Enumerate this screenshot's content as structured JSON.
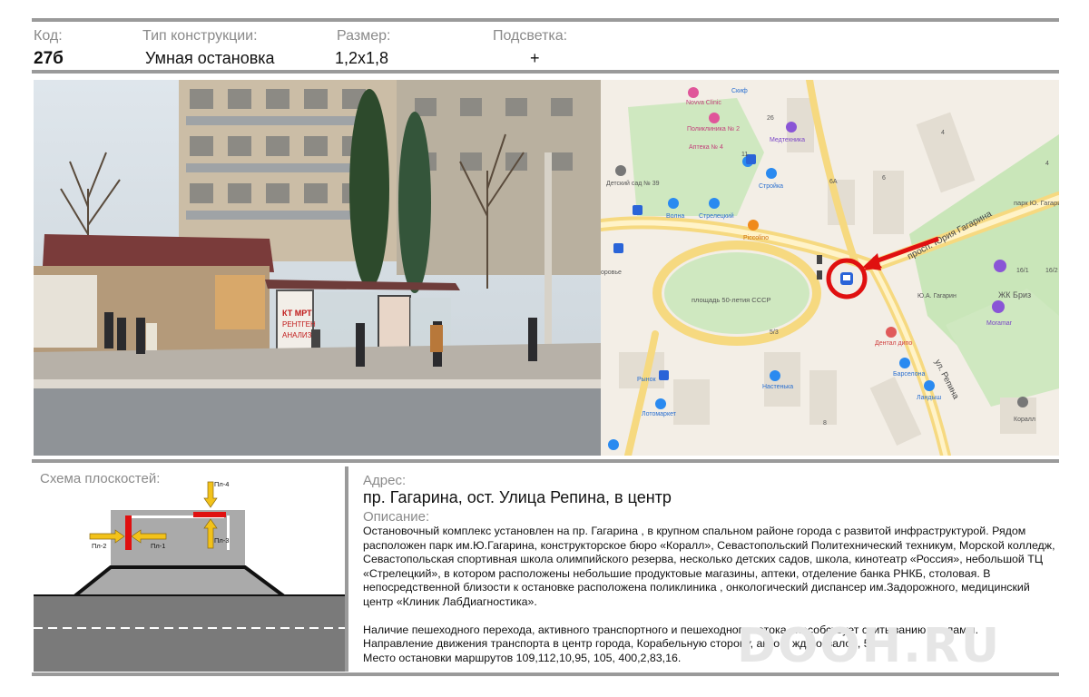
{
  "header": {
    "labels": {
      "code": "Код:",
      "type": "Тип конструкции:",
      "size": "Размер:",
      "light": "Подсветка:"
    },
    "values": {
      "code": "27б",
      "type": "Умная остановка",
      "size": "1,2x1,8",
      "light": "+"
    }
  },
  "photo": {
    "sign_line1": "КТ МРТ",
    "sign_line2": "РЕНТГЕН",
    "sign_line3": "АНАЛИЗЫ"
  },
  "map": {
    "labels": {
      "novva": "Novva Clinic",
      "skif": "Скиф",
      "poliklinika": "Поликлиника № 2",
      "apteka": "Аптека № 4",
      "medtehnika": "Медтехника",
      "stroyka": "Стройка",
      "detsad": "Детский сад № 39",
      "volna": "Волна",
      "streletsky": "Стрелецкий",
      "picollino": "Piccolino",
      "zdorovye": "оровье",
      "prospekt": "просп. Юрия Гагарина",
      "park": "парк Ю. Гагарина",
      "ploshad": "площадь 50-летия СССР",
      "yua": "Ю.А. Гагарин",
      "zhk": "ЖК Бриз",
      "moramar": "Moramar",
      "dental": "Дентал дипо",
      "rynok": "Рынок",
      "nastenka": "Настенька",
      "barselona": "Барселона",
      "landysh": "Ландыш",
      "ulrepina": "ул. Репина",
      "lotomarket": "Лотомаркет",
      "korall": "Коралл",
      "n26": "26",
      "n11": "11",
      "n4": "4",
      "n6a": "6А",
      "n6": "6",
      "n53": "5/3",
      "n8": "8",
      "n161": "16/1",
      "n162": "16/2",
      "n4b": "4"
    }
  },
  "schema": {
    "title": "Схема плоскостей:",
    "planes": {
      "p1": "Пл-1",
      "p2": "Пл-2",
      "p3": "Пл-3",
      "p4": "Пл-4"
    }
  },
  "info": {
    "address_label": "Адрес:",
    "address": "пр. Гагарина, ост. Улица Репина, в центр",
    "description_label": "Описание:",
    "paragraph1": "Остановочный комплекс установлен на пр. Гагарина , в крупном спальном районе города  с развитой инфраструктурой. Рядом расположен  парк им.Ю.Гагарина,   конструкторское бюро «Коралл», Севастопольский Политехнический техникум, Морской колледж,  Севастопольская спортивная школа олимпийского резерва,  несколько детских садов, школа, кинотеатр «Россия», небольшой  ТЦ «Стрелецкий», в котором расположены небольшие продуктовые магазины, аптеки, отделение банка РНКБ, столовая. В непосредственной близости к остановке расположена поликлиника , онкологический диспансер им.Задорожного, медицинский центр «Клиник ЛабДиагностика».",
    "paragraph2_line1": "Наличие пешеходного перехода, активного транспортного и пешеходного потока способствует считыванию рекламы.",
    "paragraph2_line2": "Направление движения транспорта в центр города, Корабельную сторону, авто и жд-вокзалов, 5 км.",
    "paragraph2_line3": "Место остановки маршрутов 109,112,10,95, 105, 400,2,83,16."
  },
  "watermark": "DOOH.RU",
  "colors": {
    "accent_red": "#e01010",
    "pin_blue": "#2a64d8",
    "arrow_yellow": "#f2c21a",
    "frame_gray": "#9a9a9a"
  }
}
